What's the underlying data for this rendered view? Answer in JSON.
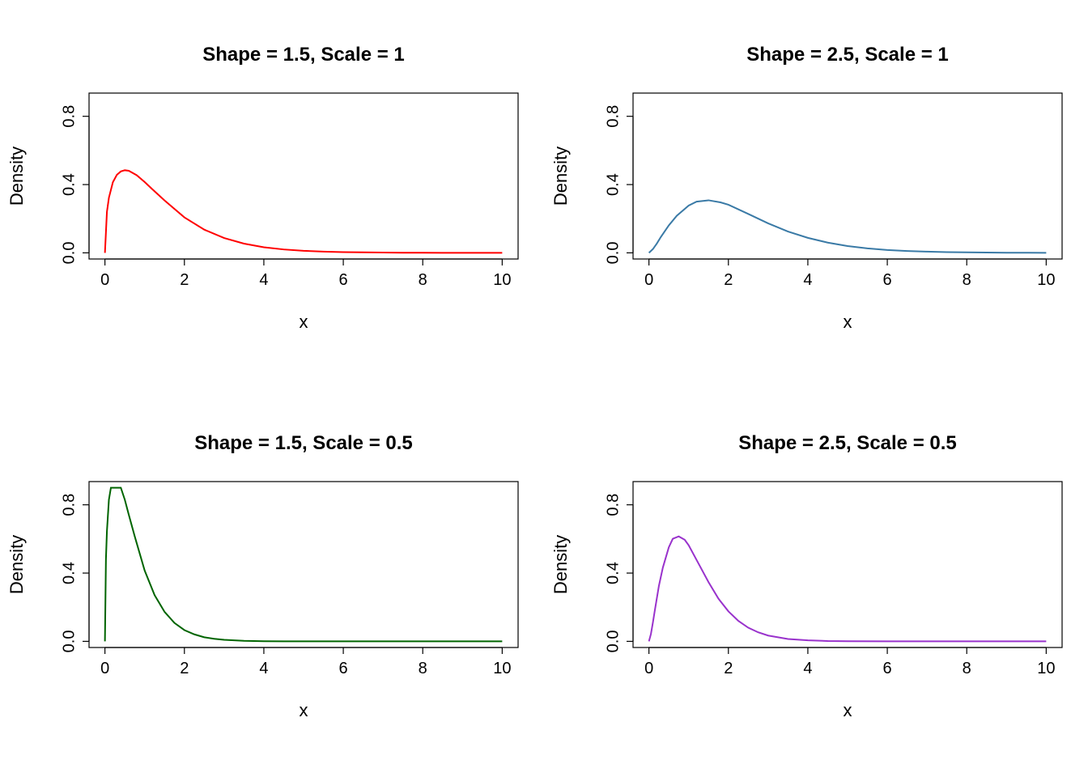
{
  "chart_data": [
    {
      "type": "line",
      "title": "Shape = 1.5, Scale = 1",
      "xlabel": "x",
      "ylabel": "Density",
      "xlim": [
        0,
        10
      ],
      "ylim": [
        0,
        0.9
      ],
      "x_ticks": [
        0,
        2,
        4,
        6,
        8,
        10
      ],
      "y_ticks": [
        0.0,
        0.4,
        0.8
      ],
      "color": "#ff0000",
      "shape": 1.5,
      "scale": 1.0,
      "x": [
        0,
        0.05,
        0.1,
        0.2,
        0.3,
        0.4,
        0.5,
        0.6,
        0.8,
        1,
        1.2,
        1.5,
        2,
        2.5,
        3,
        3.5,
        4,
        4.5,
        5,
        5.5,
        6,
        6.5,
        7,
        7.5,
        8,
        8.5,
        9,
        9.5,
        10
      ],
      "y": [
        0,
        0.24,
        0.323,
        0.414,
        0.457,
        0.477,
        0.484,
        0.481,
        0.455,
        0.415,
        0.371,
        0.307,
        0.208,
        0.136,
        0.087,
        0.054,
        0.033,
        0.02,
        0.012,
        0.007,
        0.004,
        0.003,
        0.002,
        0.001,
        0.001,
        0.0,
        0.0,
        0.0,
        0.0
      ]
    },
    {
      "type": "line",
      "title": "Shape = 2.5, Scale = 1",
      "xlabel": "x",
      "ylabel": "Density",
      "xlim": [
        0,
        10
      ],
      "ylim": [
        0,
        0.9
      ],
      "x_ticks": [
        0,
        2,
        4,
        6,
        8,
        10
      ],
      "y_ticks": [
        0.0,
        0.4,
        0.8
      ],
      "color": "#3a7aa6",
      "shape": 2.5,
      "scale": 1.0,
      "x": [
        0,
        0.1,
        0.2,
        0.3,
        0.5,
        0.7,
        1,
        1.2,
        1.5,
        1.8,
        2,
        2.5,
        3,
        3.5,
        4,
        4.5,
        5,
        5.5,
        6,
        6.5,
        7,
        7.5,
        8,
        8.5,
        9,
        9.5,
        10
      ],
      "y": [
        0,
        0.022,
        0.055,
        0.093,
        0.161,
        0.217,
        0.277,
        0.3,
        0.308,
        0.296,
        0.282,
        0.228,
        0.173,
        0.125,
        0.088,
        0.06,
        0.04,
        0.026,
        0.017,
        0.011,
        0.007,
        0.004,
        0.003,
        0.002,
        0.001,
        0.001,
        0.0
      ]
    },
    {
      "type": "line",
      "title": "Shape = 1.5, Scale = 0.5",
      "xlabel": "x",
      "ylabel": "Density",
      "xlim": [
        0,
        10
      ],
      "ylim": [
        0,
        0.9
      ],
      "x_ticks": [
        0,
        2,
        4,
        6,
        8,
        10
      ],
      "y_ticks": [
        0.0,
        0.4,
        0.8
      ],
      "color": "#006400",
      "shape": 1.5,
      "scale": 0.5,
      "x": [
        0,
        0.025,
        0.05,
        0.1,
        0.15,
        0.2,
        0.25,
        0.3,
        0.4,
        0.5,
        0.6,
        0.75,
        1,
        1.25,
        1.5,
        1.75,
        2,
        2.25,
        2.5,
        2.75,
        3,
        3.5,
        4,
        4.5,
        5,
        6,
        7,
        8,
        9,
        10
      ],
      "y": [
        0,
        0.48,
        0.645,
        0.83,
        0.916,
        0.952,
        0.968,
        0.963,
        0.91,
        0.83,
        0.742,
        0.615,
        0.415,
        0.271,
        0.173,
        0.108,
        0.066,
        0.041,
        0.024,
        0.015,
        0.009,
        0.003,
        0.001,
        0.0,
        0.0,
        0.0,
        0.0,
        0.0,
        0.0,
        0.0
      ]
    },
    {
      "type": "line",
      "title": "Shape = 2.5, Scale = 0.5",
      "xlabel": "x",
      "ylabel": "Density",
      "xlim": [
        0,
        10
      ],
      "ylim": [
        0,
        0.9
      ],
      "x_ticks": [
        0,
        2,
        4,
        6,
        8,
        10
      ],
      "y_ticks": [
        0.0,
        0.4,
        0.8
      ],
      "color": "#9932cc",
      "shape": 2.5,
      "scale": 0.5,
      "x": [
        0,
        0.05,
        0.1,
        0.15,
        0.25,
        0.35,
        0.5,
        0.6,
        0.75,
        0.9,
        1,
        1.25,
        1.5,
        1.75,
        2,
        2.25,
        2.5,
        2.75,
        3,
        3.5,
        4,
        4.5,
        5,
        6,
        7,
        8,
        9,
        10
      ],
      "y": [
        0,
        0.043,
        0.111,
        0.184,
        0.324,
        0.432,
        0.551,
        0.601,
        0.615,
        0.595,
        0.563,
        0.455,
        0.347,
        0.25,
        0.176,
        0.12,
        0.08,
        0.053,
        0.034,
        0.014,
        0.006,
        0.002,
        0.001,
        0.0,
        0.0,
        0.0,
        0.0,
        0.0
      ]
    }
  ]
}
